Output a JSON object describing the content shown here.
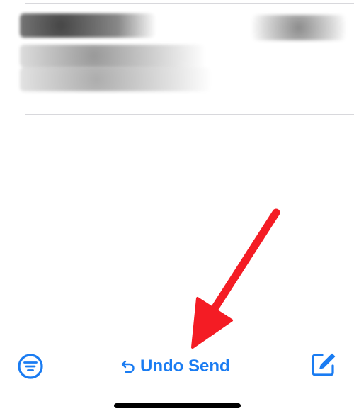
{
  "toolbar": {
    "undo_send_label": "Undo Send",
    "filter_icon": "filter-list-icon",
    "compose_icon": "compose-icon",
    "undo_icon": "undo-arrow-icon"
  },
  "colors": {
    "accent": "#1a7cf2",
    "annotation_arrow": "#f41c24",
    "divider": "#d8d8dc"
  }
}
